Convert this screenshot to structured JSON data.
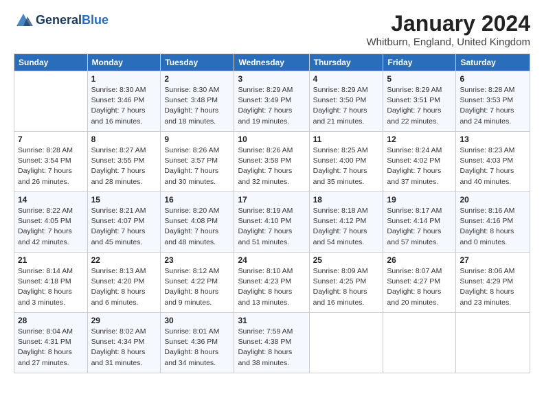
{
  "header": {
    "logo_line1": "General",
    "logo_line2": "Blue",
    "month": "January 2024",
    "location": "Whitburn, England, United Kingdom"
  },
  "weekdays": [
    "Sunday",
    "Monday",
    "Tuesday",
    "Wednesday",
    "Thursday",
    "Friday",
    "Saturday"
  ],
  "weeks": [
    [
      {
        "day": "",
        "sunrise": "",
        "sunset": "",
        "daylight": ""
      },
      {
        "day": "1",
        "sunrise": "Sunrise: 8:30 AM",
        "sunset": "Sunset: 3:46 PM",
        "daylight": "Daylight: 7 hours and 16 minutes."
      },
      {
        "day": "2",
        "sunrise": "Sunrise: 8:30 AM",
        "sunset": "Sunset: 3:48 PM",
        "daylight": "Daylight: 7 hours and 18 minutes."
      },
      {
        "day": "3",
        "sunrise": "Sunrise: 8:29 AM",
        "sunset": "Sunset: 3:49 PM",
        "daylight": "Daylight: 7 hours and 19 minutes."
      },
      {
        "day": "4",
        "sunrise": "Sunrise: 8:29 AM",
        "sunset": "Sunset: 3:50 PM",
        "daylight": "Daylight: 7 hours and 21 minutes."
      },
      {
        "day": "5",
        "sunrise": "Sunrise: 8:29 AM",
        "sunset": "Sunset: 3:51 PM",
        "daylight": "Daylight: 7 hours and 22 minutes."
      },
      {
        "day": "6",
        "sunrise": "Sunrise: 8:28 AM",
        "sunset": "Sunset: 3:53 PM",
        "daylight": "Daylight: 7 hours and 24 minutes."
      }
    ],
    [
      {
        "day": "7",
        "sunrise": "Sunrise: 8:28 AM",
        "sunset": "Sunset: 3:54 PM",
        "daylight": "Daylight: 7 hours and 26 minutes."
      },
      {
        "day": "8",
        "sunrise": "Sunrise: 8:27 AM",
        "sunset": "Sunset: 3:55 PM",
        "daylight": "Daylight: 7 hours and 28 minutes."
      },
      {
        "day": "9",
        "sunrise": "Sunrise: 8:26 AM",
        "sunset": "Sunset: 3:57 PM",
        "daylight": "Daylight: 7 hours and 30 minutes."
      },
      {
        "day": "10",
        "sunrise": "Sunrise: 8:26 AM",
        "sunset": "Sunset: 3:58 PM",
        "daylight": "Daylight: 7 hours and 32 minutes."
      },
      {
        "day": "11",
        "sunrise": "Sunrise: 8:25 AM",
        "sunset": "Sunset: 4:00 PM",
        "daylight": "Daylight: 7 hours and 35 minutes."
      },
      {
        "day": "12",
        "sunrise": "Sunrise: 8:24 AM",
        "sunset": "Sunset: 4:02 PM",
        "daylight": "Daylight: 7 hours and 37 minutes."
      },
      {
        "day": "13",
        "sunrise": "Sunrise: 8:23 AM",
        "sunset": "Sunset: 4:03 PM",
        "daylight": "Daylight: 7 hours and 40 minutes."
      }
    ],
    [
      {
        "day": "14",
        "sunrise": "Sunrise: 8:22 AM",
        "sunset": "Sunset: 4:05 PM",
        "daylight": "Daylight: 7 hours and 42 minutes."
      },
      {
        "day": "15",
        "sunrise": "Sunrise: 8:21 AM",
        "sunset": "Sunset: 4:07 PM",
        "daylight": "Daylight: 7 hours and 45 minutes."
      },
      {
        "day": "16",
        "sunrise": "Sunrise: 8:20 AM",
        "sunset": "Sunset: 4:08 PM",
        "daylight": "Daylight: 7 hours and 48 minutes."
      },
      {
        "day": "17",
        "sunrise": "Sunrise: 8:19 AM",
        "sunset": "Sunset: 4:10 PM",
        "daylight": "Daylight: 7 hours and 51 minutes."
      },
      {
        "day": "18",
        "sunrise": "Sunrise: 8:18 AM",
        "sunset": "Sunset: 4:12 PM",
        "daylight": "Daylight: 7 hours and 54 minutes."
      },
      {
        "day": "19",
        "sunrise": "Sunrise: 8:17 AM",
        "sunset": "Sunset: 4:14 PM",
        "daylight": "Daylight: 7 hours and 57 minutes."
      },
      {
        "day": "20",
        "sunrise": "Sunrise: 8:16 AM",
        "sunset": "Sunset: 4:16 PM",
        "daylight": "Daylight: 8 hours and 0 minutes."
      }
    ],
    [
      {
        "day": "21",
        "sunrise": "Sunrise: 8:14 AM",
        "sunset": "Sunset: 4:18 PM",
        "daylight": "Daylight: 8 hours and 3 minutes."
      },
      {
        "day": "22",
        "sunrise": "Sunrise: 8:13 AM",
        "sunset": "Sunset: 4:20 PM",
        "daylight": "Daylight: 8 hours and 6 minutes."
      },
      {
        "day": "23",
        "sunrise": "Sunrise: 8:12 AM",
        "sunset": "Sunset: 4:22 PM",
        "daylight": "Daylight: 8 hours and 9 minutes."
      },
      {
        "day": "24",
        "sunrise": "Sunrise: 8:10 AM",
        "sunset": "Sunset: 4:23 PM",
        "daylight": "Daylight: 8 hours and 13 minutes."
      },
      {
        "day": "25",
        "sunrise": "Sunrise: 8:09 AM",
        "sunset": "Sunset: 4:25 PM",
        "daylight": "Daylight: 8 hours and 16 minutes."
      },
      {
        "day": "26",
        "sunrise": "Sunrise: 8:07 AM",
        "sunset": "Sunset: 4:27 PM",
        "daylight": "Daylight: 8 hours and 20 minutes."
      },
      {
        "day": "27",
        "sunrise": "Sunrise: 8:06 AM",
        "sunset": "Sunset: 4:29 PM",
        "daylight": "Daylight: 8 hours and 23 minutes."
      }
    ],
    [
      {
        "day": "28",
        "sunrise": "Sunrise: 8:04 AM",
        "sunset": "Sunset: 4:31 PM",
        "daylight": "Daylight: 8 hours and 27 minutes."
      },
      {
        "day": "29",
        "sunrise": "Sunrise: 8:02 AM",
        "sunset": "Sunset: 4:34 PM",
        "daylight": "Daylight: 8 hours and 31 minutes."
      },
      {
        "day": "30",
        "sunrise": "Sunrise: 8:01 AM",
        "sunset": "Sunset: 4:36 PM",
        "daylight": "Daylight: 8 hours and 34 minutes."
      },
      {
        "day": "31",
        "sunrise": "Sunrise: 7:59 AM",
        "sunset": "Sunset: 4:38 PM",
        "daylight": "Daylight: 8 hours and 38 minutes."
      },
      {
        "day": "",
        "sunrise": "",
        "sunset": "",
        "daylight": ""
      },
      {
        "day": "",
        "sunrise": "",
        "sunset": "",
        "daylight": ""
      },
      {
        "day": "",
        "sunrise": "",
        "sunset": "",
        "daylight": ""
      }
    ]
  ]
}
